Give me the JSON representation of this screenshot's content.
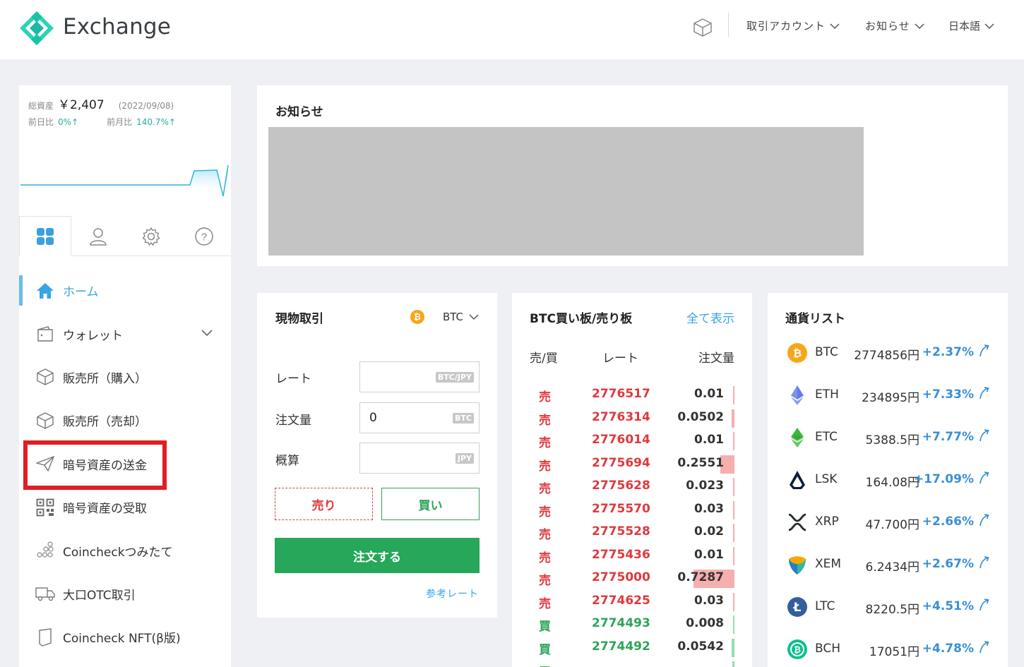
{
  "header": {
    "brand": "Exchange",
    "menus": [
      {
        "label": "取引アカウント"
      },
      {
        "label": "お知らせ"
      },
      {
        "label": "日本語"
      }
    ]
  },
  "assets": {
    "label": "総資産",
    "value": "￥2,407",
    "date": "(2022/09/08)",
    "day_label": "前日比",
    "day_change": "0%↑",
    "month_label": "前月比",
    "month_change": "140.7%↑"
  },
  "nav": [
    {
      "label": "ホーム",
      "icon": "home-icon",
      "active": true
    },
    {
      "label": "ウォレット",
      "icon": "wallet-icon"
    },
    {
      "label": "販売所（購入）",
      "icon": "cube-icon"
    },
    {
      "label": "販売所（売却）",
      "icon": "cube-icon"
    },
    {
      "label": "暗号資産の送金",
      "icon": "send-icon"
    },
    {
      "label": "暗号資産の受取",
      "icon": "qr-code-icon"
    },
    {
      "label": "Coincheckつみたて",
      "icon": "coin-stack-icon"
    },
    {
      "label": "大口OTC取引",
      "icon": "truck-icon"
    },
    {
      "label": "Coincheck NFT(β版)",
      "icon": "card-icon"
    }
  ],
  "notice": {
    "title": "お知らせ"
  },
  "spot": {
    "title": "現物取引",
    "coin": "BTC",
    "coin_glyph": "₿",
    "rate_label": "レート",
    "rate_unit": "BTC/JPY",
    "amount_label": "注文量",
    "amount_value": "0",
    "amount_unit": "BTC",
    "estimate_label": "概算",
    "estimate_unit": "JPY",
    "sell": "売り",
    "buy": "買い",
    "order": "注文する",
    "reference": "参考レート"
  },
  "orderbook": {
    "title": "BTC買い板/売り板",
    "show_all": "全て表示",
    "col_side": "売/買",
    "col_rate": "レート",
    "col_qty": "注文量",
    "rows": [
      {
        "side": "売",
        "type": "sell",
        "rate": "2776517",
        "qty": "0.01",
        "depth": 0.01
      },
      {
        "side": "売",
        "type": "sell",
        "rate": "2776314",
        "qty": "0.0502",
        "depth": 0.07
      },
      {
        "side": "売",
        "type": "sell",
        "rate": "2776014",
        "qty": "0.01",
        "depth": 0.01
      },
      {
        "side": "売",
        "type": "sell",
        "rate": "2775694",
        "qty": "0.2551",
        "depth": 0.35
      },
      {
        "side": "売",
        "type": "sell",
        "rate": "2775628",
        "qty": "0.023",
        "depth": 0.03
      },
      {
        "side": "売",
        "type": "sell",
        "rate": "2775570",
        "qty": "0.03",
        "depth": 0.04
      },
      {
        "side": "売",
        "type": "sell",
        "rate": "2775528",
        "qty": "0.02",
        "depth": 0.03
      },
      {
        "side": "売",
        "type": "sell",
        "rate": "2775436",
        "qty": "0.01",
        "depth": 0.01
      },
      {
        "side": "売",
        "type": "sell",
        "rate": "2775000",
        "qty": "0.7287",
        "depth": 1.0
      },
      {
        "side": "売",
        "type": "sell",
        "rate": "2774625",
        "qty": "0.03",
        "depth": 0.04
      },
      {
        "side": "買",
        "type": "buy",
        "rate": "2774493",
        "qty": "0.008",
        "depth": 0.01
      },
      {
        "side": "買",
        "type": "buy",
        "rate": "2774492",
        "qty": "0.0542",
        "depth": 0.07
      },
      {
        "side": "買",
        "type": "buy",
        "rate": "",
        "qty": "",
        "depth": 0.05
      }
    ]
  },
  "currencies": {
    "title": "通貨リスト",
    "items": [
      {
        "symbol": "BTC",
        "price": "2774856円",
        "change": "+2.37%",
        "icon": "bitcoin-icon",
        "color": "#f7a61b"
      },
      {
        "symbol": "ETH",
        "price": "234895円",
        "change": "+7.33%",
        "icon": "ethereum-icon",
        "color": "#627eea"
      },
      {
        "symbol": "ETC",
        "price": "5388.5円",
        "change": "+7.77%",
        "icon": "ethereum-classic-icon",
        "color": "#3ab83a"
      },
      {
        "symbol": "LSK",
        "price": "164.08円",
        "change": "+17.09%",
        "icon": "lisk-icon",
        "color": "#0d1e3a"
      },
      {
        "symbol": "XRP",
        "price": "47.700円",
        "change": "+2.66%",
        "icon": "xrp-icon",
        "color": "#23292f"
      },
      {
        "symbol": "XEM",
        "price": "6.2434円",
        "change": "+2.67%",
        "icon": "nem-icon",
        "color": "#f7a800"
      },
      {
        "symbol": "LTC",
        "price": "8220.5円",
        "change": "+4.51%",
        "icon": "litecoin-icon",
        "color": "#345d9d"
      },
      {
        "symbol": "BCH",
        "price": "17051円",
        "change": "+4.78%",
        "icon": "bitcoin-cash-icon",
        "color": "#0ac18e"
      }
    ]
  }
}
